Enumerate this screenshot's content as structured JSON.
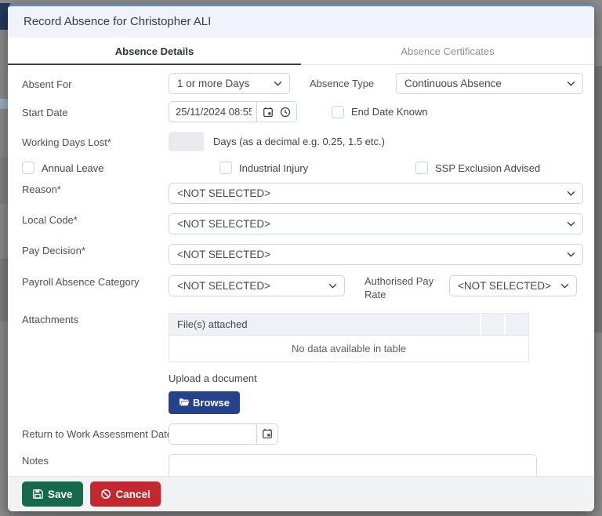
{
  "modal": {
    "title": "Record Absence for Christopher ALI",
    "tabs": [
      {
        "label": "Absence Details"
      },
      {
        "label": "Absence Certificates"
      }
    ]
  },
  "form": {
    "absent_for": {
      "label": "Absent For",
      "value": "1 or more Days"
    },
    "absence_type": {
      "label": "Absence Type",
      "value": "Continuous Absence"
    },
    "start_date": {
      "label": "Start Date",
      "value": "25/11/2024 08:55"
    },
    "end_date_known": {
      "label": "End Date Known",
      "checked": false
    },
    "working_days_lost": {
      "label": "Working Days Lost*",
      "value": "",
      "hint": "Days (as a decimal e.g. 0.25, 1.5 etc.)"
    },
    "flags": [
      {
        "label": "Annual Leave",
        "checked": false
      },
      {
        "label": "Industrial Injury",
        "checked": false
      },
      {
        "label": "SSP Exclusion Advised",
        "checked": false
      }
    ],
    "reason": {
      "label": "Reason*",
      "value": "<NOT SELECTED>"
    },
    "local_code": {
      "label": "Local Code*",
      "value": "<NOT SELECTED>"
    },
    "pay_decision": {
      "label": "Pay Decision*",
      "value": "<NOT SELECTED>"
    },
    "payroll_absence_category": {
      "label": "Payroll Absence Category",
      "value": "<NOT SELECTED>"
    },
    "authorised_pay_rate": {
      "label": "Authorised Pay Rate",
      "value": "<NOT SELECTED>"
    },
    "attachments": {
      "label": "Attachments",
      "table_header": "File(s) attached",
      "empty_text": "No data available in table",
      "upload_label": "Upload a document",
      "browse_label": "Browse"
    },
    "return_to_work": {
      "label": "Return to Work Assessment Date",
      "value": ""
    },
    "notes": {
      "label": "Notes",
      "value": ""
    }
  },
  "footer": {
    "save_label": "Save",
    "cancel_label": "Cancel"
  },
  "icons": {
    "calendar": "calendar-icon",
    "clock": "clock-icon",
    "chevron": "chevron-down-icon",
    "folder": "folder-open-icon",
    "save": "floppy-disk-icon",
    "cancel": "no-entry-icon"
  },
  "colors": {
    "accent_top_border": "#4a90e2",
    "header_bg": "#f0f4fa",
    "save_button": "#17694c",
    "cancel_button": "#c3282f",
    "browse_button": "#27428d",
    "overlay": "#8c8c8c",
    "table_header_bg": "#eef2f7"
  }
}
